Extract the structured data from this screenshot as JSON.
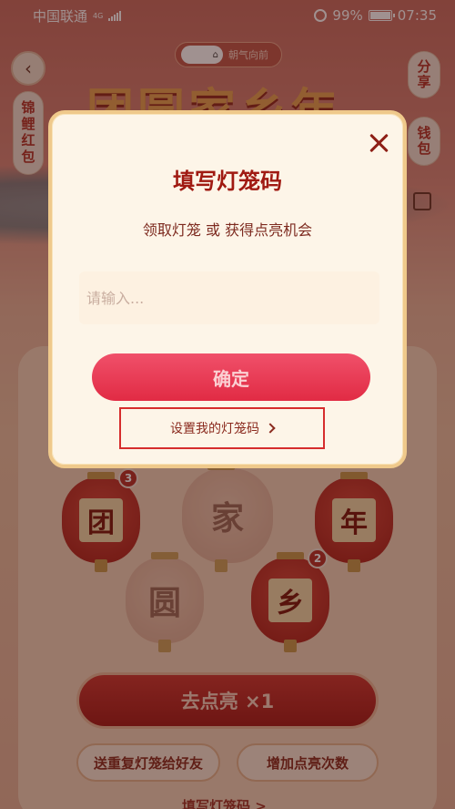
{
  "status_bar": {
    "carrier": "中国联通",
    "network": "4G",
    "battery": "99%",
    "battery_level": 0.99,
    "time": "07:35"
  },
  "header": {
    "slogan": "朝气向前",
    "back_icon": "chevron-left-icon"
  },
  "side": {
    "koi_label": "锦鲤红包",
    "share_label": "分享",
    "wallet_label": "钱包",
    "scan_icon": "scan-icon"
  },
  "background": {
    "banner_title": "团圆家乡年",
    "lanterns": [
      {
        "char": "团",
        "count": "3"
      },
      {
        "char": "家",
        "count": ""
      },
      {
        "char": "年",
        "count": ""
      },
      {
        "char": "圆",
        "count": ""
      },
      {
        "char": "乡",
        "count": "2"
      }
    ],
    "light_button": "去点亮 ×1",
    "send_button": "送重复灯笼给好友",
    "add_button": "增加点亮次数",
    "bottom_link": "填写灯笼码 >"
  },
  "dialog": {
    "title": "填写灯笼码",
    "subtitle": "领取灯笼 或 获得点亮机会",
    "input_placeholder": "请输入...",
    "input_value": "",
    "confirm_label": "确定",
    "set_code_label": "设置我的灯笼码",
    "close_icon": "close-icon"
  }
}
